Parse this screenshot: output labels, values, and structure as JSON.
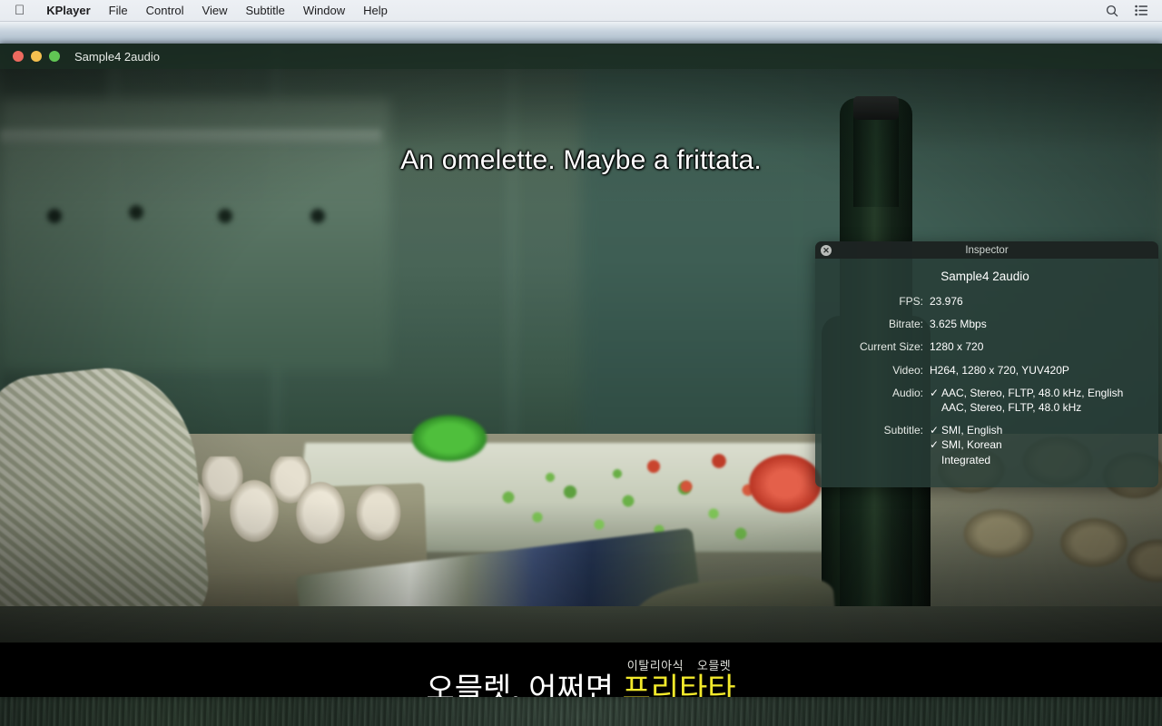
{
  "menubar": {
    "apple_icon": "apple-logo-icon",
    "items": [
      {
        "label": "KPlayer",
        "bold": true
      },
      {
        "label": "File",
        "bold": false
      },
      {
        "label": "Control",
        "bold": false
      },
      {
        "label": "View",
        "bold": false
      },
      {
        "label": "Subtitle",
        "bold": false
      },
      {
        "label": "Window",
        "bold": false
      },
      {
        "label": "Help",
        "bold": false
      }
    ],
    "right_icons": [
      "search-icon",
      "control-center-icon"
    ]
  },
  "window": {
    "title": "Sample4 2audio",
    "traffic_lights": [
      "close-button",
      "minimize-button",
      "maximize-button"
    ]
  },
  "subtitles": {
    "english": "An omelette. Maybe a frittata.",
    "korean_plain": "오믈렛, 어쩌면 ",
    "korean_highlight": "프리타타",
    "korean_ruby": "이탈리아식 오믈렛",
    "highlight_color": "#f2e92b"
  },
  "inspector": {
    "title": "Inspector",
    "close_label": "✕",
    "media_name": "Sample4 2audio",
    "rows": [
      {
        "key": "FPS:",
        "values": [
          {
            "text": "23.976",
            "check": "none"
          }
        ]
      },
      {
        "key": "Bitrate:",
        "values": [
          {
            "text": "3.625 Mbps",
            "check": "none"
          }
        ]
      },
      {
        "key": "Current Size:",
        "values": [
          {
            "text": "1280 x 720",
            "check": "none"
          }
        ]
      },
      {
        "key": "Video:",
        "values": [
          {
            "text": "H264, 1280 x 720, YUV420P",
            "check": "none"
          }
        ]
      },
      {
        "key": "Audio:",
        "values": [
          {
            "text": "AAC, Stereo, FLTP, 48.0 kHz, English",
            "check": "on"
          },
          {
            "text": "AAC, Stereo, FLTP, 48.0 kHz",
            "check": "off"
          }
        ]
      },
      {
        "key": "Subtitle:",
        "values": [
          {
            "text": "SMI, English",
            "check": "on"
          },
          {
            "text": "SMI, Korean",
            "check": "on"
          },
          {
            "text": "Integrated",
            "check": "off"
          }
        ]
      }
    ]
  }
}
